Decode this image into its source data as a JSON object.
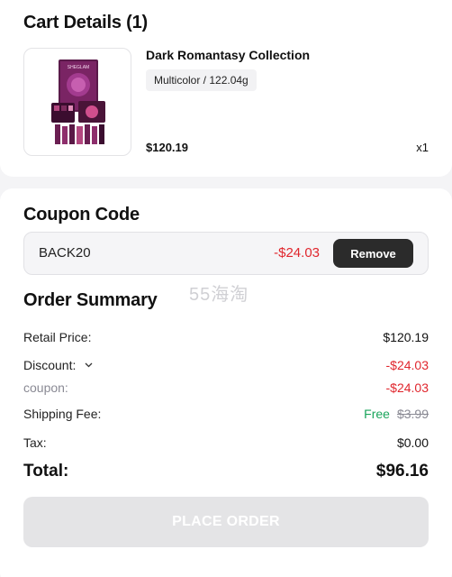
{
  "cart": {
    "title": "Cart Details (1)",
    "item": {
      "name": "Dark Romantasy Collection",
      "variant": "Multicolor / 122.04g",
      "price": "$120.19",
      "qty": "x1",
      "image_brand_text": "SHEGLAM"
    }
  },
  "coupon": {
    "title": "Coupon Code",
    "code": "BACK20",
    "amount": "-$24.03",
    "remove_label": "Remove"
  },
  "watermark": "55海淘",
  "summary": {
    "title": "Order Summary",
    "retail_label": "Retail Price:",
    "retail_value": "$120.19",
    "discount_label": "Discount:",
    "discount_value": "-$24.03",
    "coupon_label": "coupon:",
    "coupon_value": "-$24.03",
    "shipping_label": "Shipping Fee:",
    "shipping_value": "Free",
    "shipping_original": "$3.99",
    "tax_label": "Tax:",
    "tax_value": "$0.00",
    "total_label": "Total:",
    "total_value": "$96.16"
  },
  "place_order_label": "PLACE ORDER",
  "colors": {
    "accent_red": "#e0262d",
    "free_green": "#1aa55b",
    "button_dark": "#2b2b2b",
    "disabled_button": "#e4e4e6"
  }
}
